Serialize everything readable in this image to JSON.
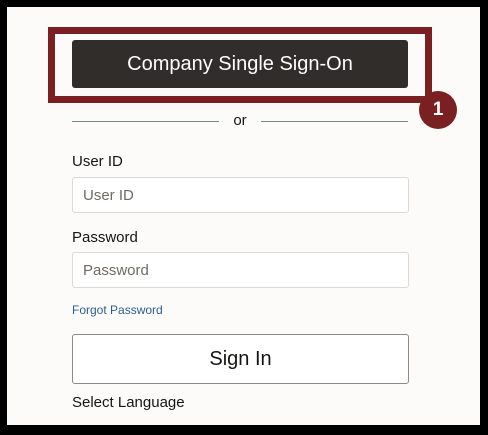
{
  "sso": {
    "button_label": "Company Single Sign-On"
  },
  "callout": {
    "number": "1",
    "color": "#7a1f22"
  },
  "divider": {
    "text": "or"
  },
  "user_id": {
    "label": "User ID",
    "placeholder": "User ID",
    "value": ""
  },
  "password": {
    "label": "Password",
    "placeholder": "Password",
    "value": ""
  },
  "forgot_password": {
    "label": "Forgot Password"
  },
  "sign_in": {
    "label": "Sign In"
  },
  "language": {
    "label": "Select Language"
  },
  "colors": {
    "sso_button_bg": "#312d2a",
    "link": "#2b5e8c",
    "divider_line": "#6f8f78"
  }
}
